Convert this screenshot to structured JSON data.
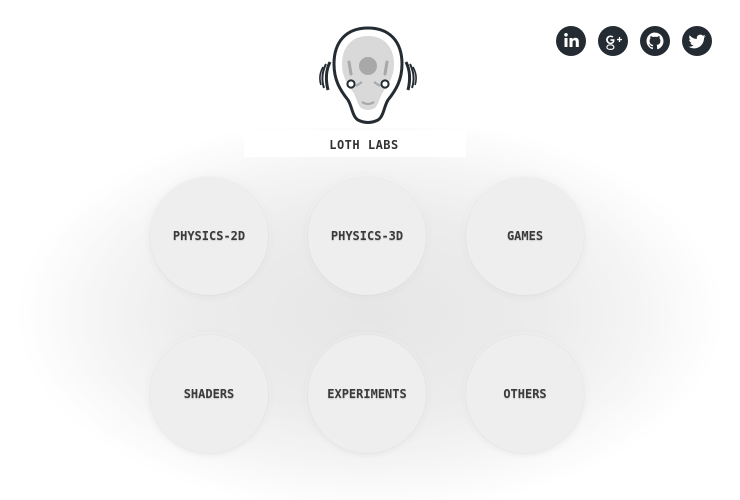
{
  "brand": {
    "title": "LOTH LABS",
    "logo_icon": "robot-head-icon"
  },
  "social": [
    {
      "name": "linkedin",
      "icon": "linkedin-icon",
      "label": "in"
    },
    {
      "name": "google-plus",
      "icon": "google-plus-icon",
      "label": "g+"
    },
    {
      "name": "github",
      "icon": "github-icon",
      "label": ""
    },
    {
      "name": "twitter",
      "icon": "twitter-icon",
      "label": ""
    }
  ],
  "categories": [
    {
      "label": "PHYSICS-2D"
    },
    {
      "label": "PHYSICS-3D"
    },
    {
      "label": "GAMES"
    },
    {
      "label": "SHADERS"
    },
    {
      "label": "EXPERIMENTS"
    },
    {
      "label": "OTHERS"
    }
  ],
  "colors": {
    "icon_dark": "#252b32",
    "circle_bg": "#eeeeee",
    "text": "#3a3a3a"
  }
}
